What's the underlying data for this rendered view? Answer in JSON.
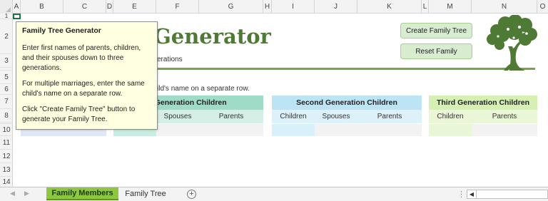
{
  "columns": [
    "A",
    "B",
    "C",
    "D",
    "E",
    "F",
    "G",
    "H",
    "I",
    "J",
    "K",
    "L",
    "M",
    "N",
    "O"
  ],
  "rows": [
    "1",
    "2",
    "3",
    "5",
    "6",
    "7",
    "8",
    "10",
    "11",
    "12",
    "13",
    "14"
  ],
  "header": {
    "title": "Generator",
    "subtitle": "erations",
    "note": "ild's name on a separate row."
  },
  "buttons": {
    "create": "Create Family Tree",
    "reset": "Reset Family"
  },
  "tables": {
    "first": {
      "title": "t Generation Children",
      "subheaders": [
        "Spouses",
        "Parents"
      ]
    },
    "second": {
      "title": "Second Generation Children",
      "subheaders": [
        "Children",
        "Spouses",
        "Parents"
      ]
    },
    "third": {
      "title": "Third Generation Children",
      "subheaders": [
        "Children",
        "Parents"
      ]
    }
  },
  "tooltip": {
    "title": "Family Tree Generator",
    "p1": "Enter first names of parents, children, and their spouses down to three generations.",
    "p2": "For multiple marriages, enter the same child's name on a separate row.",
    "p3": "Click \"Create Family Tree\" button to generate your Family Tree."
  },
  "sheet_tabs": {
    "active": "Family Members",
    "inactive": "Family Tree",
    "add_symbol": "+"
  },
  "colors": {
    "accent_green": "#78a24b",
    "title_green": "#4f7a35",
    "gen1_header": "#9fdcc8",
    "gen1_sub": "#d3efe6",
    "gen2_header": "#bde4f5",
    "gen2_sub": "#dcf1fa",
    "gen3_header": "#d6efb2",
    "gen3_sub": "#eaf7d7"
  },
  "icons": {
    "tree": "tree-icon",
    "add": "add-sheet-icon"
  }
}
